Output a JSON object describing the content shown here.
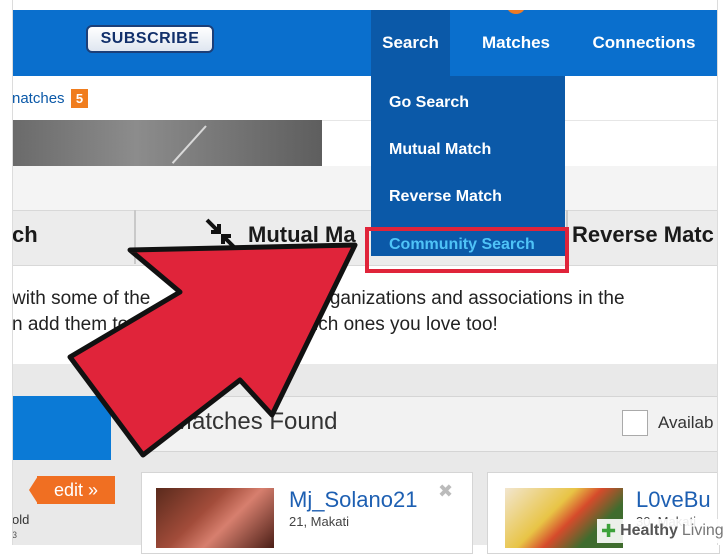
{
  "header": {
    "subscribe_label": "SUBSCRIBE",
    "nav": {
      "search": "Search",
      "matches": "Matches",
      "connections": "Connections"
    }
  },
  "subnav": {
    "matches_label": "natches",
    "matches_count": "5"
  },
  "dropdown": {
    "items": [
      "Go Search",
      "Mutual Match",
      "Reverse Match",
      "Community Search"
    ]
  },
  "tabs": {
    "left_partial": "ch",
    "mutual": "Mutual Ma",
    "reverse": "Reverse Matc"
  },
  "description": {
    "line1": "with some of the                     ands, organizations and associations in the",
    "line2": "n add them to                         ow which ones you love too!"
  },
  "results": {
    "count_text": "3 Matches Found",
    "available_label": "Availab"
  },
  "sidebar": {
    "edit_label": "edit »",
    "small_text": "old",
    "tiny_text": "3"
  },
  "cards": [
    {
      "name": "Mj_Solano21",
      "location": "21, Makati"
    },
    {
      "name": "L0veBu",
      "location": "30, Makati"
    }
  ],
  "watermark": {
    "healthy": "Healthy",
    "living": "Living"
  },
  "colors": {
    "nav_blue": "#0a6fcd",
    "dropdown_blue": "#0b59a8",
    "highlight_red": "#e0243a",
    "arrow_red": "#e0243a",
    "badge_orange": "#f07d1e"
  }
}
